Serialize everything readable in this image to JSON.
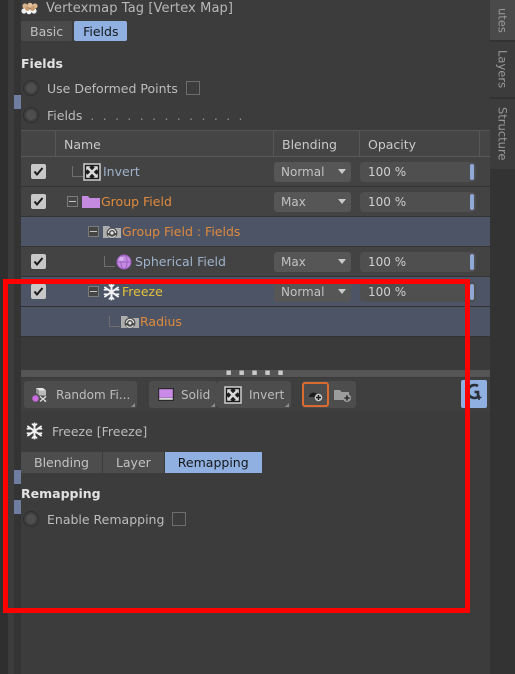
{
  "window": {
    "title": "Vertexmap Tag [Vertex Map]",
    "tag_icon": "vertexmap-tag-icon"
  },
  "tabs": [
    {
      "label": "Basic",
      "active": false
    },
    {
      "label": "Fields",
      "active": true
    }
  ],
  "fields_section": {
    "heading": "Fields",
    "options": [
      {
        "label": "Use Deformed Points",
        "control": "checkbox",
        "checked": false,
        "dots": ""
      },
      {
        "label": "Fields",
        "control": "dots",
        "checked": false,
        "dots": ". . . . . . . . . . . . ."
      }
    ]
  },
  "layer_table": {
    "columns": [
      "",
      "Name",
      "Blending",
      "Opacity",
      ""
    ],
    "rows": [
      {
        "enabled": true,
        "icon": "invert-icon",
        "name": "Invert",
        "name_color": "blue",
        "blending": "Normal",
        "opacity": "100 %",
        "indent": 1,
        "expander": "none",
        "selected": false,
        "has_controls": true
      },
      {
        "enabled": true,
        "icon": "purple-folder-icon",
        "name": "Group Field",
        "name_color": "orange",
        "blending": "Max",
        "opacity": "100 %",
        "indent": 1,
        "expander": "minus",
        "selected": false,
        "has_controls": true
      },
      {
        "enabled": false,
        "icon": "field-folder-icon",
        "name": "Group Field : Fields",
        "name_color": "orange",
        "blending": "",
        "opacity": "",
        "indent": 2,
        "expander": "minus",
        "selected": true,
        "has_controls": false
      },
      {
        "enabled": true,
        "icon": "spherical-field-icon",
        "name": "Spherical Field",
        "name_color": "blue",
        "blending": "Max",
        "opacity": "100 %",
        "indent": 3,
        "expander": "none",
        "selected": false,
        "has_controls": true
      },
      {
        "enabled": true,
        "icon": "freeze-icon",
        "name": "Freeze",
        "name_color": "yellow",
        "blending": "Normal",
        "opacity": "100 %",
        "indent": 2,
        "expander": "minus",
        "selected": true,
        "has_controls": true
      },
      {
        "enabled": false,
        "icon": "field-folder-icon",
        "name": "Radius",
        "name_color": "orange",
        "blending": "",
        "opacity": "",
        "indent": 3,
        "expander": "none",
        "selected": true,
        "has_controls": false
      }
    ]
  },
  "toolbar": {
    "buttons": [
      {
        "label": "Random Fi...",
        "icon": "random-field-icon"
      },
      {
        "label": "Solid",
        "icon": "solid-layer-icon"
      },
      {
        "label": "Invert",
        "icon": "invert-icon"
      }
    ],
    "add_layer_label": "",
    "add_group_label": "",
    "corner_button_icon": "group-add-icon"
  },
  "object_panel": {
    "icon": "freeze-icon",
    "title": "Freeze [Freeze]",
    "tabs": [
      {
        "label": "Blending",
        "active": false
      },
      {
        "label": "Layer",
        "active": false
      },
      {
        "label": "Remapping",
        "active": true
      }
    ],
    "heading": "Remapping",
    "option": {
      "label": "Enable Remapping",
      "checked": false
    }
  },
  "right_rail": {
    "tabs": [
      "utes",
      "Layers",
      "Structure"
    ]
  },
  "colors": {
    "accent_blue": "#8fb0e0",
    "orange_text": "#e08a3c",
    "yellow_text": "#e3c23c",
    "annotation_red": "#fe0000",
    "purple": "#c48ae0",
    "selection_row": "#4c5465"
  }
}
